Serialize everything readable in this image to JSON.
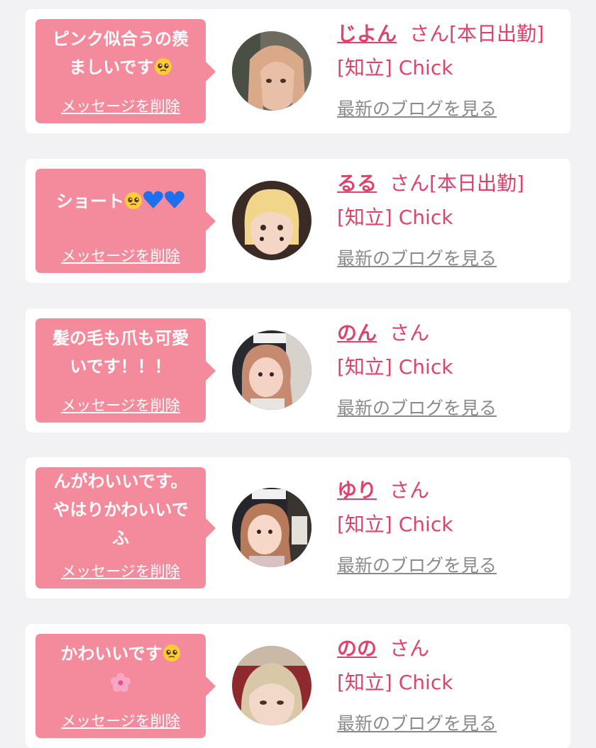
{
  "theme": {
    "bubble": "#f48b9c",
    "name": "#e0426a",
    "blog_link": "#8a8a8a",
    "background": "#f2f2f4"
  },
  "cards": [
    {
      "message_lines": [
        "ピンク似合うの羨",
        "ましいです"
      ],
      "message_emojis": [
        "pleading-face"
      ],
      "delete_label": "メッセージを削除",
      "name": "じよん",
      "suffix": "さん[本日出勤]",
      "shop": "[知立] Chick",
      "blog_label": "最新のブログを見る"
    },
    {
      "message_lines": [
        "ショート"
      ],
      "message_emojis": [
        "pleading-face",
        "blue-heart",
        "blue-heart"
      ],
      "delete_label": "メッセージを削除",
      "name": "るる",
      "suffix": "さん[本日出勤]",
      "shop": "[知立] Chick",
      "blog_label": "最新のブログを見る"
    },
    {
      "message_lines": [
        "髪の毛も爪も可愛",
        "いです！！！"
      ],
      "message_emojis": [],
      "delete_label": "メッセージを削除",
      "name": "のん",
      "suffix": "さん",
      "shop": "[知立] Chick",
      "blog_label": "最新のブログを見る"
    },
    {
      "message_lines": [
        "んがわいいです。",
        "やはりかわいいで",
        "ふ"
      ],
      "message_emojis": [],
      "delete_label": "メッセージを削除",
      "name": "ゆり",
      "suffix": "さん",
      "shop": "[知立] Chick",
      "blog_label": "最新のブログを見る"
    },
    {
      "message_lines": [
        "かわいいです",
        ""
      ],
      "message_emojis": [
        "pleading-face",
        "cherry-blossom"
      ],
      "delete_label": "メッセージを削除",
      "name": "のの",
      "suffix": "さん",
      "shop": "[知立] Chick",
      "blog_label": "最新のブログを見る"
    }
  ]
}
